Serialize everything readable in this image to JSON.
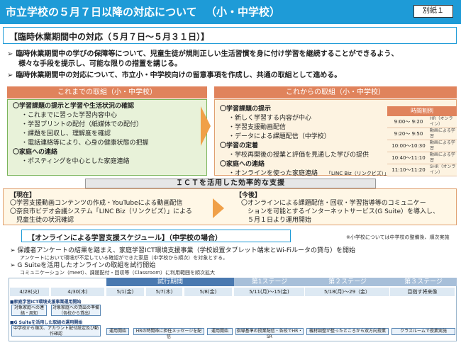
{
  "header": {
    "title": "市立学校の５月７日以降の対応について",
    "subtitle": "（小・中学校）",
    "exhibit": "別紙１"
  },
  "period_title": "【臨時休業期間中の対応（５月７日～５月３１日）】",
  "bullets": [
    "臨時休業期間中の学びの保障等について、児童生徒が規則正しい生活習慣を身に付け学習を継続することができるよう、",
    "様々な手段を提示し、可能な限りの措置を講じる。",
    "臨時休業期間中の対応について、市立小・中学校向けの留意事項を作成し、共通の取組として進める。"
  ],
  "left_column": {
    "heading": "これまでの取組（小・中学校）",
    "lines": [
      {
        "cls": "h",
        "text": "〇学習課題の提示と学習や生活状況の確認"
      },
      {
        "cls": "i",
        "text": "・これまでに習った学習内容中心"
      },
      {
        "cls": "i",
        "text": "・学習プリントの配付（紙媒体での配付）"
      },
      {
        "cls": "i",
        "text": "・課題を回収し、理解度を確認"
      },
      {
        "cls": "i",
        "text": "・電話連絡等により、心身の健康状態の把握"
      },
      {
        "cls": "h",
        "text": "〇家庭への連絡"
      },
      {
        "cls": "i",
        "text": "・ポスティングを中心とした家庭連絡"
      }
    ]
  },
  "right_column": {
    "heading": "これからの取組（小・中学校）",
    "lines": [
      {
        "cls": "h",
        "text": "〇学習課題の提示"
      },
      {
        "cls": "i",
        "text": "・新しく学習する内容が中心"
      },
      {
        "cls": "i",
        "text": "・学習支援動画配信"
      },
      {
        "cls": "i",
        "text": "・データによる課題配信（中学校）"
      },
      {
        "cls": "h",
        "text": "〇学習の定着"
      },
      {
        "cls": "i",
        "text": "・学校再開後の授業と評価を見通した学びの提供"
      },
      {
        "cls": "h",
        "text": "〇家庭への連絡"
      },
      {
        "cls": "i",
        "text": "・オンラインを使った家庭連絡"
      }
    ],
    "linc_note": "「LINC Biz（リンクビズ）」"
  },
  "timetable": {
    "heading": "時間割例",
    "rows": [
      {
        "time": "9:00～ 9:20",
        "content": "HR（オンライン）"
      },
      {
        "time": "9:20～ 9:50",
        "content": "動画による学習"
      },
      {
        "time": "10:00～10:30",
        "content": "動画による学習"
      },
      {
        "time": "10:40～11:10",
        "content": "動画による学習"
      },
      {
        "time": "11:10～11:20",
        "content": "SHR（オンライン）"
      }
    ]
  },
  "ict": {
    "banner": "ＩＣＴを活用した効率的な支援",
    "current_label": "【現在】",
    "current_lines": [
      "〇学習支援動画コンテンツの作成・YouTubeによる動画配信",
      "〇奈良市ビデオ会議システム「LINC Biz（リンクビズ）」による",
      "　児童生徒の状況確認"
    ],
    "future_label": "【今後】",
    "future_lines": [
      "〇オンラインによる課題配信・回収・学習指導等のコミュニケー",
      "　ションを可能とするインターネットサービス(G Suite）を導入し、",
      "　５月１日より運用開始"
    ]
  },
  "schedule": {
    "title": "【オンラインによる学習支援スケジュール】（中学校の場合）",
    "note": "※小学校については中学校の整備後、順次実施",
    "bullet1": "保護者アンケートの結果を踏まえ、家庭学習ICT環境支援事業（学校設置タブレット端末とWi-Fiルータの貸与）を開始",
    "bullet1_sub": "アンケートにおいて環境が不足している確認ができた家庭（中学校から順次）を対象とする。",
    "bullet2": "G Suiteを活用したオンラインの取組を試行開始",
    "bullet2_sub": "コミュニケーション（meet）、課題配付・回収等（Classroom）に利用範囲を順次拡大",
    "trial_label": "試行期間",
    "stages": [
      "第1ステージ",
      "第２ステージ",
      "第３ステージ"
    ],
    "dates": [
      "4/28(火)",
      "4/30(木)",
      "5/1(金)",
      "5/7(木)",
      "5/8(金)",
      "5/11(月)～15(金)",
      "5/18(月)～29（金）",
      "目指す将来像"
    ],
    "row1_label": "■家庭学習ICT環境支援事業運用開始",
    "row1_tasks": [
      "対象家庭への連絡・周知",
      "対象家庭への貸出の準備（各校から貸出）"
    ],
    "row2_label": "■G Suiteを活用した取組の運用開始",
    "row2_tasks": [
      "中学校から順次、アカウント配付設定及び動作確認",
      "運用開始",
      "HRの時間帯に担任メッセージを配信",
      "運用開始",
      "指導基準の授業配信・各校でHR・SR",
      "機材調整が整ったところから双方向授業",
      "クラスルームで授業実施"
    ]
  }
}
